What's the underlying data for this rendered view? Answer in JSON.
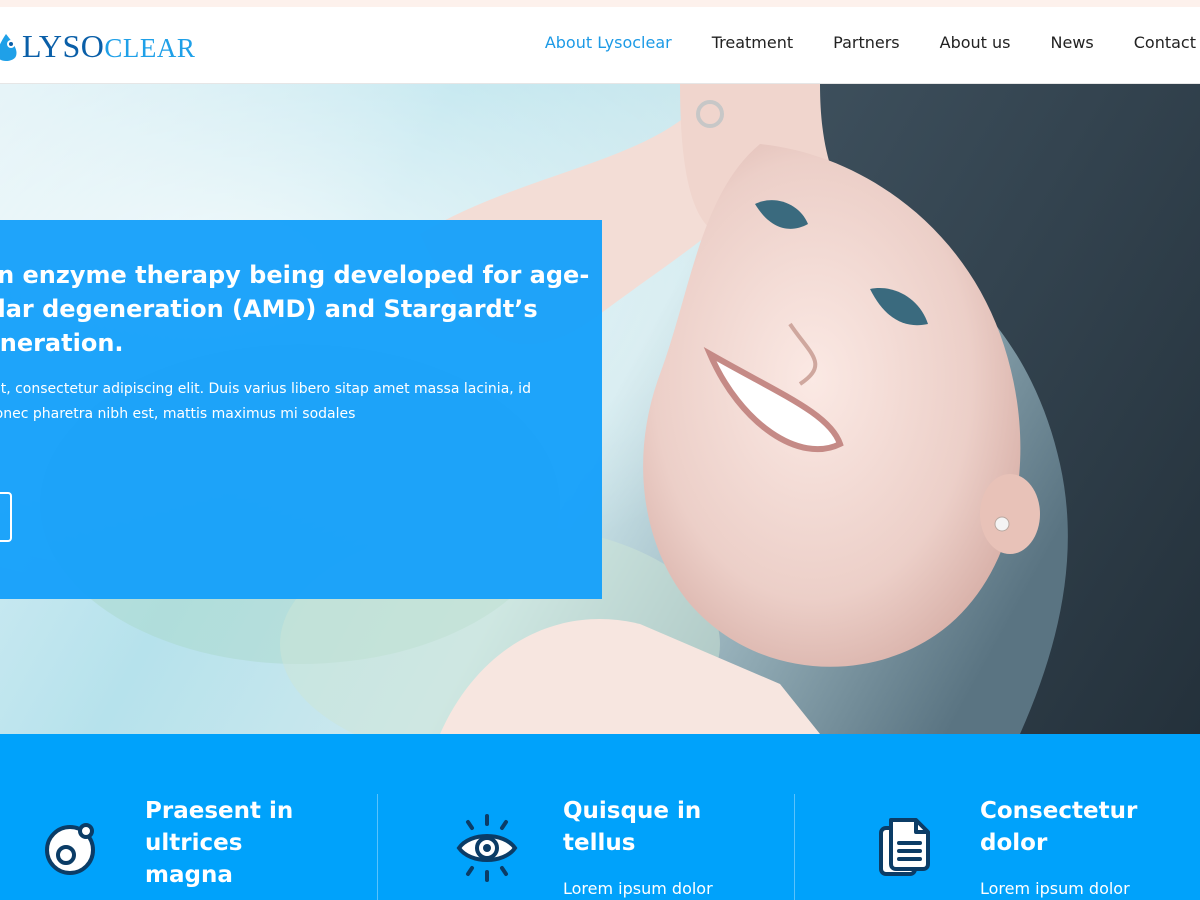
{
  "brand": {
    "name_part1": "LYSO",
    "name_part2": "CLEAR",
    "colors": {
      "dark_blue": "#0a5fa8",
      "light_blue": "#1fa0e8"
    }
  },
  "nav": {
    "items": [
      {
        "label": "About Lysoclear",
        "active": true
      },
      {
        "label": "Treatment"
      },
      {
        "label": "Partners"
      },
      {
        "label": "About us"
      },
      {
        "label": "News"
      },
      {
        "label": "Contact"
      }
    ],
    "active_color": "#1c9ae6"
  },
  "hero": {
    "title": "is an enzyme therapy being developed for age-acular degeneration (AMD) and Stargardt’s egeneration.",
    "title_lines": [
      "is an enzyme therapy being developed for age-",
      "acular degeneration (AMD) and Stargardt’s",
      "egeneration."
    ],
    "body_lines": [
      "or sit amet, consectetur adipiscing elit. Duis varius libero sitap amet massa lacinia, id",
      "haretra donec pharetra nibh est, mattis maximus mi sodales"
    ],
    "card_color": "#16a0fa"
  },
  "features": {
    "background": "#00a2fb",
    "items": [
      {
        "icon": "cell-icon",
        "title_lines": [
          "Praesent in",
          "ultrices",
          "magna"
        ],
        "subtitle": ""
      },
      {
        "icon": "eye-icon",
        "title_lines": [
          "Quisque in",
          "tellus"
        ],
        "subtitle": "Lorem ipsum dolor"
      },
      {
        "icon": "documents-icon",
        "title_lines": [
          "Consectetur",
          "dolor"
        ],
        "subtitle": "Lorem ipsum dolor"
      }
    ]
  }
}
